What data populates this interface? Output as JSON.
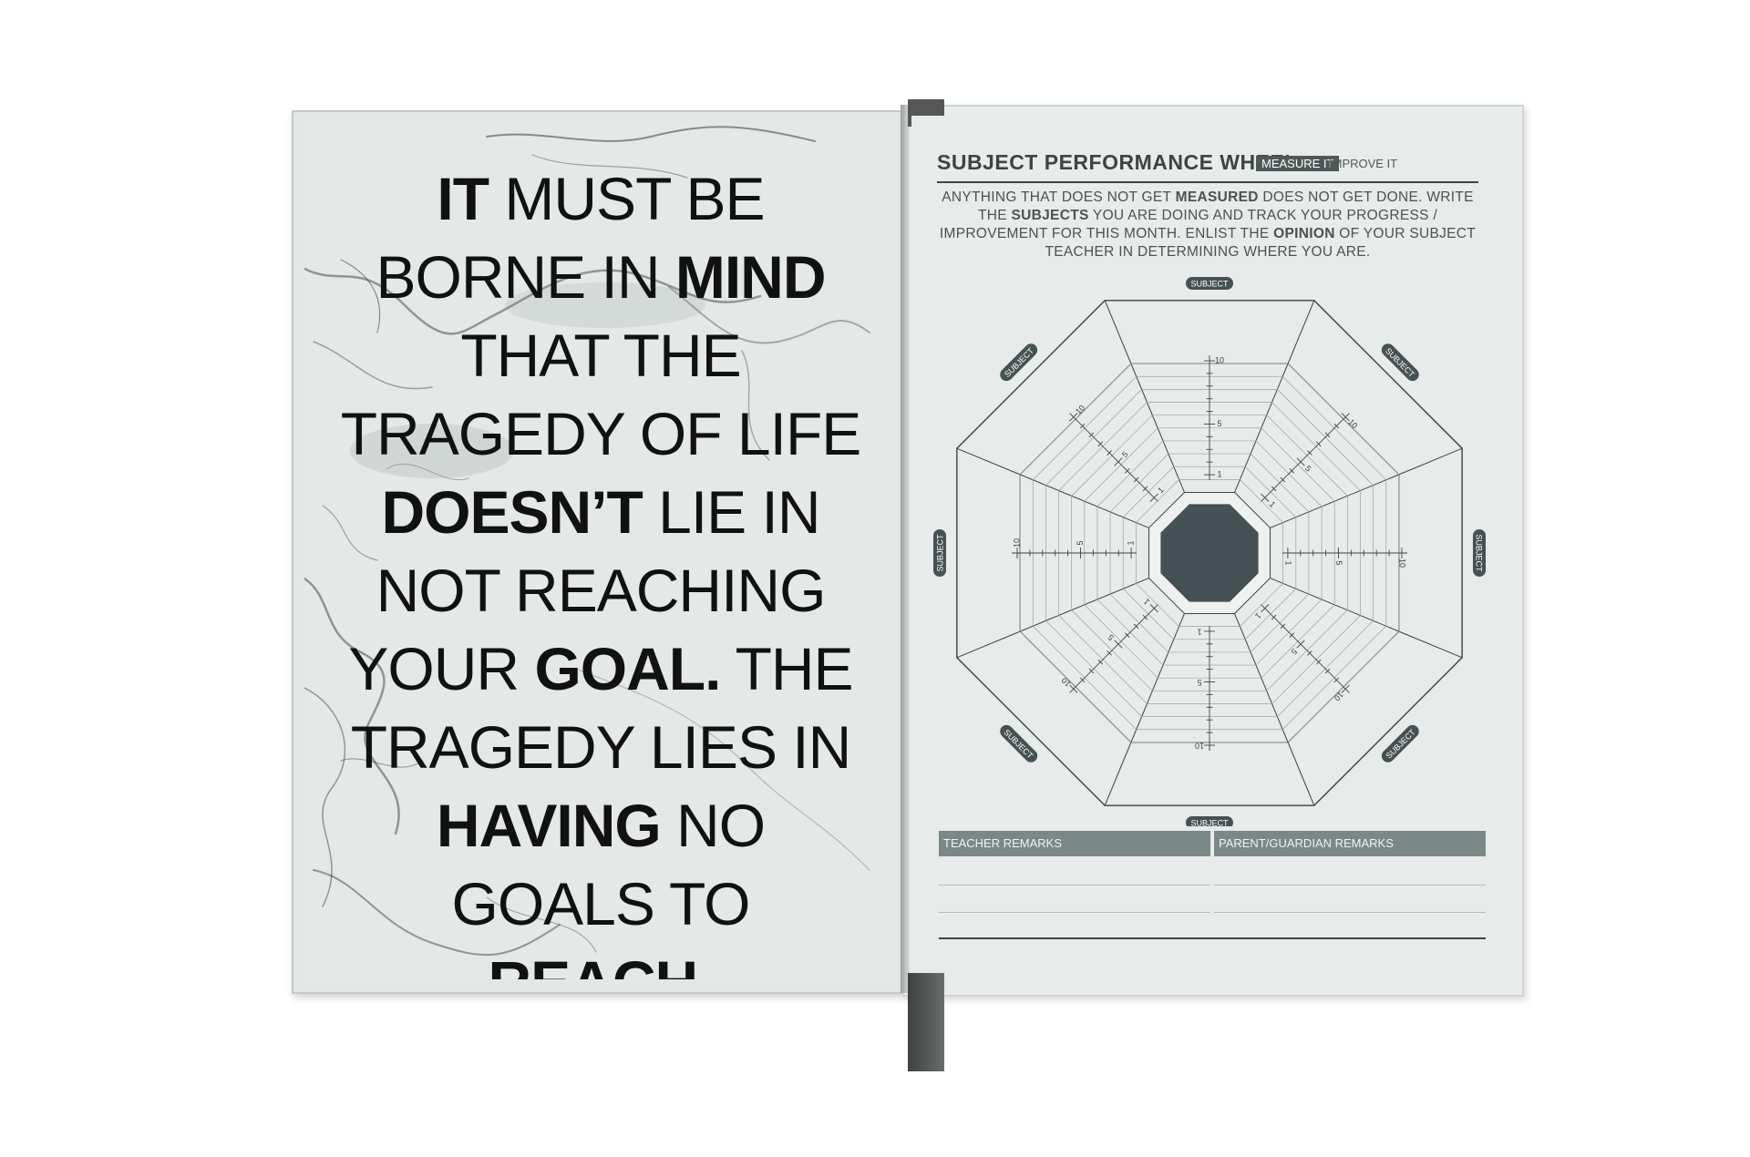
{
  "left_page": {
    "quote_segments": [
      {
        "text": "IT",
        "bold": true
      },
      {
        "text": " MUST BE BORNE IN ",
        "bold": false
      },
      {
        "text": "MIND",
        "bold": true
      },
      {
        "text": " THAT THE TRAGEDY OF LIFE ",
        "bold": false
      },
      {
        "text": "DOESN’T",
        "bold": true
      },
      {
        "text": " LIE IN NOT REACHING YOUR ",
        "bold": false
      },
      {
        "text": "GOAL.",
        "bold": true
      },
      {
        "text": " THE TRAGEDY LIES IN ",
        "bold": false
      },
      {
        "text": "HAVING",
        "bold": true
      },
      {
        "text": " NO GOALS TO ",
        "bold": false
      },
      {
        "text": "REACH.",
        "bold": true
      }
    ]
  },
  "right_page": {
    "title_light": "SUBJECT ",
    "title_bold": "PERFORMANCE",
    "title_end": " WHEEL",
    "tag_measure": "MEASURE IT",
    "tag_improve": "IMPROVE IT",
    "intro": [
      {
        "text": "ANYTHING THAT DOES NOT GET ",
        "bold": false
      },
      {
        "text": "MEASURED",
        "bold": true
      },
      {
        "text": " DOES NOT GET DONE. WRITE THE ",
        "bold": false
      },
      {
        "text": "SUBJECTS",
        "bold": true
      },
      {
        "text": " YOU ARE DOING AND TRACK YOUR PROGRESS / IMPROVEMENT FOR THIS MONTH. ENLIST THE ",
        "bold": false
      },
      {
        "text": "OPINION",
        "bold": true
      },
      {
        "text": " OF YOUR SUBJECT TEACHER IN DETERMINING WHERE YOU ARE.",
        "bold": false
      }
    ],
    "wheel": {
      "segments": 8,
      "scale_min": 1,
      "scale_max": 10,
      "tick_labels": [
        "1",
        "5",
        "10"
      ],
      "subject_label": "SUBJECT",
      "subject_labels": [
        "SUBJECT",
        "SUBJECT",
        "SUBJECT",
        "SUBJECT",
        "SUBJECT",
        "SUBJECT",
        "SUBJECT",
        "SUBJECT"
      ]
    },
    "remarks": {
      "teacher": "TEACHER REMARKS",
      "parent": "PARENT/GUARDIAN REMARKS"
    }
  },
  "colors": {
    "page": "#e7ebe9",
    "ink": "#3c4444",
    "hub": "#455152",
    "remarks_bar": "#7b8888",
    "ribbon": "#555757"
  }
}
